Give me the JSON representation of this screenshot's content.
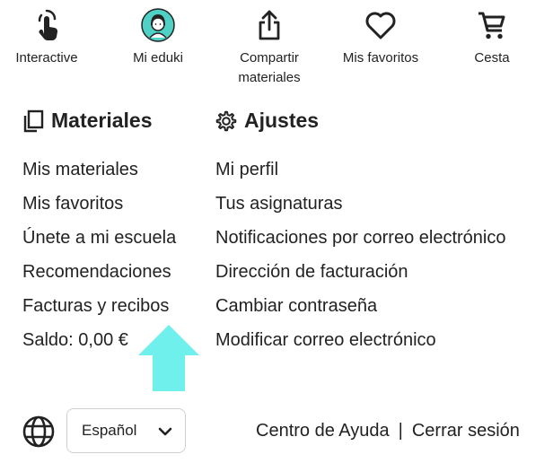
{
  "nav": {
    "items": [
      {
        "label": "Interactive",
        "icon": "touch-hand-icon"
      },
      {
        "label": "Mi eduki",
        "icon": "avatar-icon"
      },
      {
        "label": "Compartir materiales",
        "icon": "share-upload-icon"
      },
      {
        "label": "Mis favoritos",
        "icon": "heart-icon"
      },
      {
        "label": "Cesta",
        "icon": "cart-icon"
      }
    ]
  },
  "materiales": {
    "title": "Materiales",
    "icon": "copy-icon",
    "links": [
      "Mis materiales",
      "Mis favoritos",
      "Únete a mi escuela",
      "Recomendaciones",
      "Facturas y recibos",
      "Saldo: 0,00 €"
    ]
  },
  "ajustes": {
    "title": "Ajustes",
    "icon": "gear-icon",
    "links": [
      "Mi perfil",
      "Tus asignaturas",
      "Notificaciones por correo electrónico",
      "Dirección de facturación",
      "Cambiar contraseña",
      "Modificar correo electrónico"
    ]
  },
  "footer": {
    "language": "Español",
    "help": "Centro de Ayuda",
    "separator": "|",
    "logout": "Cerrar sesión"
  },
  "colors": {
    "text": "#222222",
    "avatar_bg": "#4fd1c5",
    "arrow": "#6ff0ec"
  }
}
